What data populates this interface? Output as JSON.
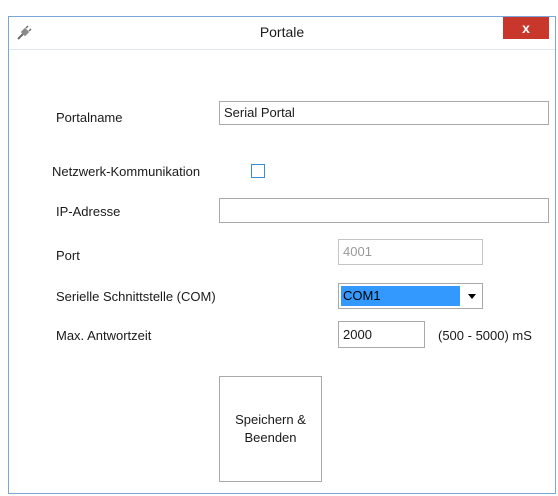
{
  "window": {
    "title": "Portale",
    "close_label": "x"
  },
  "form": {
    "portalname": {
      "label": "Portalname",
      "value": "Serial Portal"
    },
    "netzwerk": {
      "label": "Netzwerk-Kommunikation",
      "checked": false
    },
    "ip": {
      "label": "IP-Adresse",
      "value": ""
    },
    "port": {
      "label": "Port",
      "value": "4001"
    },
    "com": {
      "label": "Serielle Schnittstelle (COM)",
      "selected": "COM1"
    },
    "antwortzeit": {
      "label": "Max. Antwortzeit",
      "value": "2000",
      "range_hint": "(500 - 5000) mS"
    }
  },
  "save_button": {
    "line1": "Speichern &",
    "line2": "Beenden"
  },
  "colors": {
    "accent": "#3399ff",
    "close": "#c9372c",
    "border": "#7aa6da"
  },
  "icons": {
    "app": "plug-icon",
    "dropdown": "chevron-down-icon"
  }
}
